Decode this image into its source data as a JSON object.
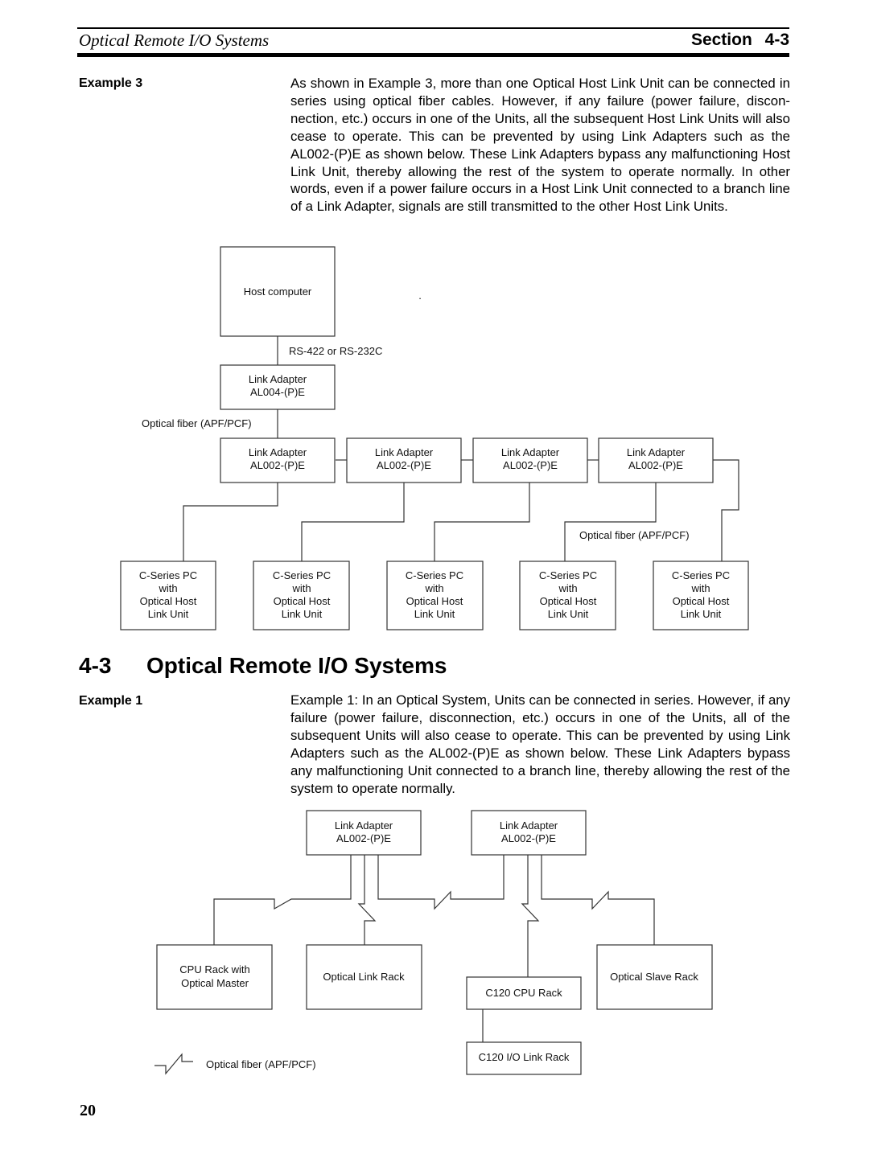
{
  "header": {
    "title": "Optical Remote I/O Systems",
    "section_label": "Section",
    "section_number": "4-3"
  },
  "example3": {
    "label": "Example 3",
    "text": "As shown in Example 3, more than one Optical Host Link Unit can be connected in series using optical fiber cables. However, if any failure (power failure, discon-nection, etc.) occurs in one of the Units, all the subsequent Host Link Units will also cease to operate. This can be prevented by using Link Adapters such as the AL002-(P)E as shown below. These Link Adapters bypass any malfunctioning Host Link Unit, thereby allowing the rest of the system to operate normally. In other words, even if a power failure occurs in a Host Link Unit connected to a branch line of a Link Adapter, signals are still transmitted to the other Host Link Units.",
    "diagram": {
      "host_computer": "Host computer",
      "dot": ".",
      "rs_label": "RS-422 or RS-232C",
      "al004": [
        "Link Adapter",
        "AL004-(P)E"
      ],
      "fiber_label_top": "Optical fiber (APF/PCF)",
      "al002": [
        [
          "Link Adapter",
          "AL002-(P)E"
        ],
        [
          "Link Adapter",
          "AL002-(P)E"
        ],
        [
          "Link Adapter",
          "AL002-(P)E"
        ],
        [
          "Link Adapter",
          "AL002-(P)E"
        ]
      ],
      "fiber_label_mid": "Optical fiber (APF/PCF)",
      "pcs": [
        [
          "C-Series PC",
          "with",
          "Optical Host",
          "Link Unit"
        ],
        [
          "C-Series PC",
          "with",
          "Optical Host",
          "Link Unit"
        ],
        [
          "C-Series PC",
          "with",
          "Optical Host",
          "Link Unit"
        ],
        [
          "C-Series PC",
          "with",
          "Optical Host",
          "Link Unit"
        ],
        [
          "C-Series PC",
          "with",
          "Optical Host",
          "Link Unit"
        ]
      ]
    }
  },
  "section": {
    "number": "4-3",
    "title": "Optical Remote I/O Systems"
  },
  "example1": {
    "label": "Example 1",
    "text": "Example 1: In an Optical System, Units can be connected in series. However, if any failure (power failure, disconnection, etc.) occurs in one of the Units, all of the subsequent Units will also cease to operate. This can be prevented by using Link Adapters such as the AL002-(P)E as shown below. These Link Adapters bypass any malfunctioning Unit connected to a branch line, thereby allowing the rest of the system to operate normally.",
    "diagram": {
      "adapters": [
        [
          "Link Adapter",
          "AL002-(P)E"
        ],
        [
          "Link Adapter",
          "AL002-(P)E"
        ]
      ],
      "cpu_rack": [
        "CPU Rack with",
        "Optical Master"
      ],
      "optical_link_rack": "Optical Link Rack",
      "c120_cpu_rack": "C120 CPU Rack",
      "optical_slave_rack": "Optical Slave Rack",
      "c120_io_link_rack": "C120 I/O Link Rack",
      "legend_icon": "optical-fiber-break-symbol",
      "legend_label": "Optical fiber (APF/PCF)"
    }
  },
  "page_number": "20"
}
